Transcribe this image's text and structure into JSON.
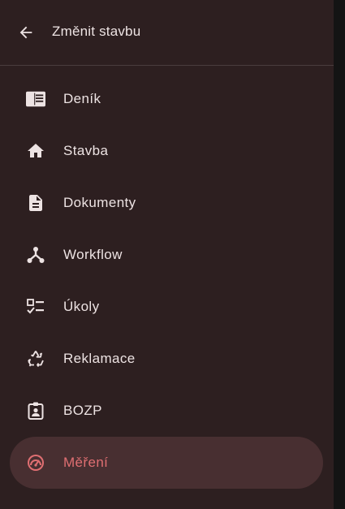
{
  "header": {
    "title": "Změnit stavbu",
    "back_icon": "arrow-back-icon"
  },
  "colors": {
    "drawer_bg": "#2d1f20",
    "text": "#ede3e3",
    "active_bg": "#482f31",
    "active_text": "#e06f72"
  },
  "nav": {
    "active_index": 7,
    "items": [
      {
        "label": "Deník",
        "icon": "journal-icon"
      },
      {
        "label": "Stavba",
        "icon": "home-icon"
      },
      {
        "label": "Dokumenty",
        "icon": "document-icon"
      },
      {
        "label": "Workflow",
        "icon": "workflow-icon"
      },
      {
        "label": "Úkoly",
        "icon": "checklist-icon"
      },
      {
        "label": "Reklamace",
        "icon": "recycle-icon"
      },
      {
        "label": "BOZP",
        "icon": "badge-icon"
      },
      {
        "label": "Měření",
        "icon": "speedometer-icon"
      }
    ]
  }
}
